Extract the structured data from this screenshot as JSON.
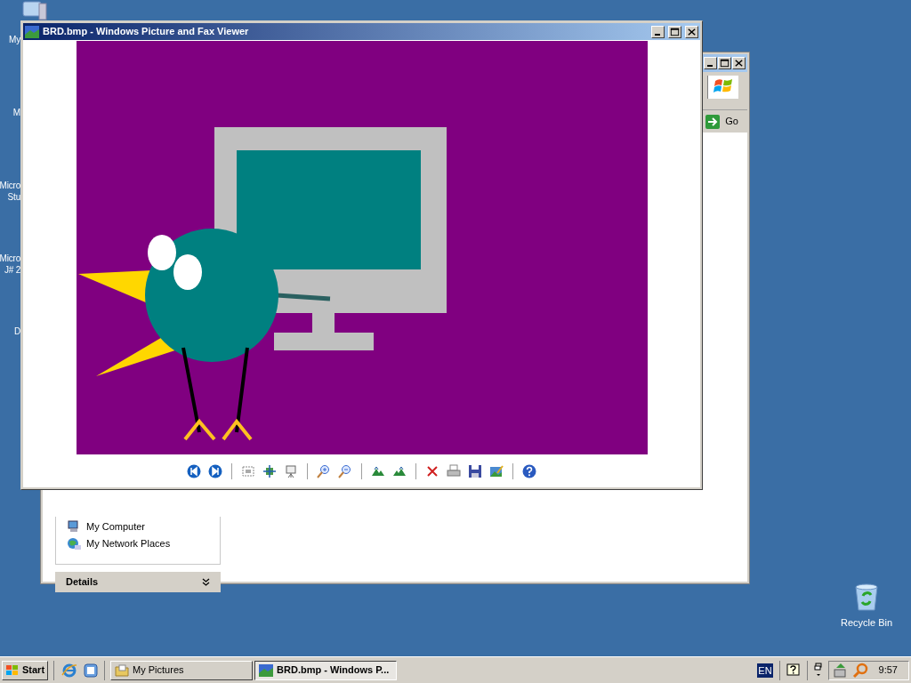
{
  "desktop": {
    "icons": [
      {
        "lines": [
          "My"
        ]
      },
      {
        "lines": [
          "M"
        ]
      },
      {
        "lines": [
          "Micro",
          "Stu"
        ]
      },
      {
        "lines": [
          "Micro",
          "J# 2"
        ]
      },
      {
        "lines": [
          "D"
        ]
      }
    ],
    "recycle_bin": {
      "label": "Recycle Bin"
    }
  },
  "explorer_window": {
    "go_button": "Go",
    "places": [
      "My Computer",
      "My Network Places"
    ],
    "details": {
      "title": "Details",
      "expanded": false
    }
  },
  "viewer": {
    "title": "BRD.bmp - Windows Picture and Fax Viewer"
  },
  "taskbar": {
    "start": "Start",
    "tasks": [
      {
        "label": "My Pictures",
        "kind": "folder",
        "selected": false
      },
      {
        "label": "BRD.bmp - Windows P...",
        "kind": "picture",
        "selected": true
      }
    ],
    "language": "EN",
    "clock": "9:57"
  }
}
